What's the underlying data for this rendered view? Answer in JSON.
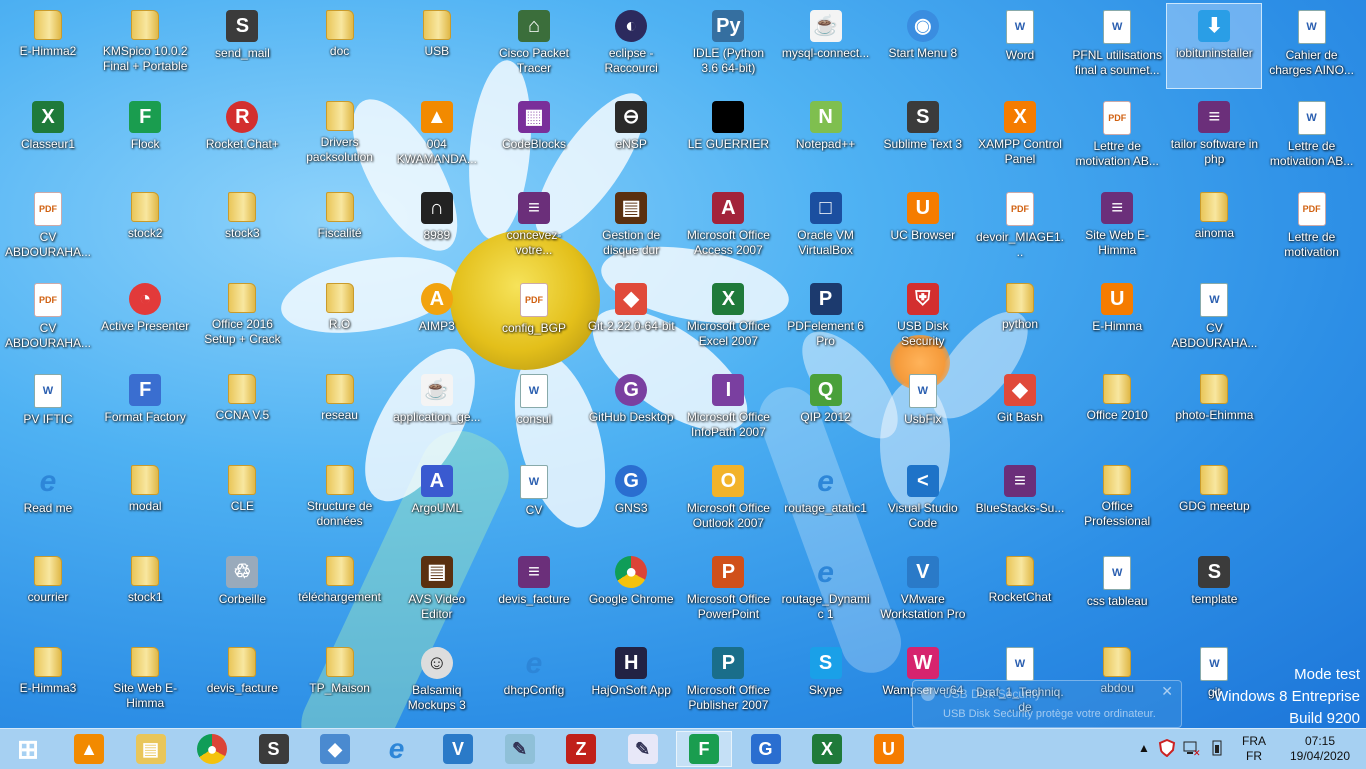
{
  "desktop": {
    "icons": [
      {
        "label": "E-Himma2",
        "glyph": "folder",
        "col": 0,
        "row": 0
      },
      {
        "label": "KMSpico 10.0.2 Final + Portable",
        "glyph": "folder",
        "col": 1,
        "row": 0
      },
      {
        "label": "send_mail",
        "glyph": "sublime",
        "col": 2,
        "row": 0
      },
      {
        "label": "doc",
        "glyph": "folder",
        "col": 3,
        "row": 0
      },
      {
        "label": "USB",
        "glyph": "folder",
        "col": 4,
        "row": 0
      },
      {
        "label": "Cisco Packet Tracer",
        "glyph": "cisco",
        "col": 5,
        "row": 0
      },
      {
        "label": "eclipse - Raccourci",
        "glyph": "eclipse",
        "col": 6,
        "row": 0
      },
      {
        "label": "IDLE (Python 3.6 64-bit)",
        "glyph": "python",
        "col": 7,
        "row": 0
      },
      {
        "label": "mysql-connect...",
        "glyph": "java",
        "col": 8,
        "row": 0
      },
      {
        "label": "Start Menu 8",
        "glyph": "startmenu",
        "col": 9,
        "row": 0
      },
      {
        "label": "Word",
        "glyph": "doc",
        "col": 10,
        "row": 0
      },
      {
        "label": "PFNL utilisations final a soumet...",
        "glyph": "doc",
        "col": 11,
        "row": 0
      },
      {
        "label": "iobituninstaller",
        "glyph": "iobit",
        "col": 12,
        "row": 0,
        "selected": true
      },
      {
        "label": "Cahier de charges AINO...",
        "glyph": "doc",
        "col": 13,
        "row": 0
      },
      {
        "label": "Classeur1",
        "glyph": "excel",
        "col": 0,
        "row": 1
      },
      {
        "label": "Flock",
        "glyph": "flock",
        "col": 1,
        "row": 1
      },
      {
        "label": "Rocket.Chat+",
        "glyph": "rocket",
        "col": 2,
        "row": 1
      },
      {
        "label": "Drivers packsolution",
        "glyph": "folder",
        "col": 3,
        "row": 1
      },
      {
        "label": "004 KWAMANDA...",
        "glyph": "vlc",
        "col": 4,
        "row": 1
      },
      {
        "label": "CodeBlocks",
        "glyph": "codeblocks",
        "col": 5,
        "row": 1
      },
      {
        "label": "eNSP",
        "glyph": "ensp",
        "col": 6,
        "row": 1
      },
      {
        "label": "LE GUERRIER",
        "glyph": "black",
        "col": 7,
        "row": 1
      },
      {
        "label": "Notepad++",
        "glyph": "notepad",
        "col": 8,
        "row": 1
      },
      {
        "label": "Sublime Text 3",
        "glyph": "sublime",
        "col": 9,
        "row": 1
      },
      {
        "label": "XAMPP Control Panel",
        "glyph": "xampp",
        "col": 10,
        "row": 1
      },
      {
        "label": "Lettre de motivation  AB...",
        "glyph": "pdf",
        "col": 11,
        "row": 1
      },
      {
        "label": "tailor software in php",
        "glyph": "rar",
        "col": 12,
        "row": 1
      },
      {
        "label": "Lettre de motivation  AB...",
        "glyph": "doc",
        "col": 13,
        "row": 1
      },
      {
        "label": "CV ABDOURAHA...",
        "glyph": "pdf",
        "col": 0,
        "row": 2
      },
      {
        "label": "stock2",
        "glyph": "folder",
        "col": 1,
        "row": 2
      },
      {
        "label": "stock3",
        "glyph": "folder",
        "col": 2,
        "row": 2
      },
      {
        "label": "Fiscalité",
        "glyph": "folder",
        "col": 3,
        "row": 2
      },
      {
        "label": "8989",
        "glyph": "mcafee",
        "col": 4,
        "row": 2
      },
      {
        "label": "concevez-votre...",
        "glyph": "rar",
        "col": 5,
        "row": 2
      },
      {
        "label": "Gestion de disque dur",
        "glyph": "film",
        "col": 6,
        "row": 2
      },
      {
        "label": "Microsoft Office Access 2007",
        "glyph": "access",
        "col": 7,
        "row": 2
      },
      {
        "label": "Oracle VM VirtualBox",
        "glyph": "vbox",
        "col": 8,
        "row": 2
      },
      {
        "label": "UC Browser",
        "glyph": "uc",
        "col": 9,
        "row": 2
      },
      {
        "label": "devoir_MIAGE1...",
        "glyph": "pdf",
        "col": 10,
        "row": 2
      },
      {
        "label": "Site Web E-Himma",
        "glyph": "rar",
        "col": 11,
        "row": 2
      },
      {
        "label": "ainoma",
        "glyph": "folder",
        "col": 12,
        "row": 2
      },
      {
        "label": "Lettre de motivation",
        "glyph": "pdf",
        "col": 13,
        "row": 2
      },
      {
        "label": "CV ABDOURAHA...",
        "glyph": "pdf",
        "col": 0,
        "row": 3
      },
      {
        "label": "Active Presenter",
        "glyph": "activepresenter",
        "col": 1,
        "row": 3
      },
      {
        "label": "Office 2016 Setup + Crack",
        "glyph": "folder",
        "col": 2,
        "row": 3
      },
      {
        "label": "R.O",
        "glyph": "folder",
        "col": 3,
        "row": 3
      },
      {
        "label": "AIMP3",
        "glyph": "aimp",
        "col": 4,
        "row": 3
      },
      {
        "label": "config_BGP",
        "glyph": "pdf",
        "col": 5,
        "row": 3
      },
      {
        "label": "Git-2.22.0-64-bit",
        "glyph": "gitinstall",
        "col": 6,
        "row": 3
      },
      {
        "label": "Microsoft Office Excel 2007",
        "glyph": "excel",
        "col": 7,
        "row": 3
      },
      {
        "label": "PDFelement 6 Pro",
        "glyph": "pdfelement",
        "col": 8,
        "row": 3
      },
      {
        "label": "USB Disk Security",
        "glyph": "usbdisk",
        "col": 9,
        "row": 3
      },
      {
        "label": "python",
        "glyph": "folder",
        "col": 10,
        "row": 3
      },
      {
        "label": "E-Himma",
        "glyph": "uc",
        "col": 11,
        "row": 3
      },
      {
        "label": "CV ABDOURAHA...",
        "glyph": "doc",
        "col": 12,
        "row": 3
      },
      {
        "label": "PV IFTIC",
        "glyph": "doc",
        "col": 0,
        "row": 4
      },
      {
        "label": "Format Factory",
        "glyph": "formatfactory",
        "col": 1,
        "row": 4
      },
      {
        "label": "CCNA V.5",
        "glyph": "folder",
        "col": 2,
        "row": 4
      },
      {
        "label": "reseau",
        "glyph": "folder",
        "col": 3,
        "row": 4
      },
      {
        "label": "application_ge...",
        "glyph": "java",
        "col": 4,
        "row": 4
      },
      {
        "label": "consul",
        "glyph": "doc",
        "col": 5,
        "row": 4
      },
      {
        "label": "GitHub Desktop",
        "glyph": "github",
        "col": 6,
        "row": 4
      },
      {
        "label": "Microsoft Office InfoPath 2007",
        "glyph": "infopath",
        "col": 7,
        "row": 4
      },
      {
        "label": "QIP 2012",
        "glyph": "qip",
        "col": 8,
        "row": 4
      },
      {
        "label": "UsbFix",
        "glyph": "doc",
        "col": 9,
        "row": 4
      },
      {
        "label": "Git Bash",
        "glyph": "gitinstall",
        "col": 10,
        "row": 4
      },
      {
        "label": "Office 2010",
        "glyph": "folder",
        "col": 11,
        "row": 4
      },
      {
        "label": "photo-Ehimma",
        "glyph": "folder",
        "col": 12,
        "row": 4
      },
      {
        "label": "Read me",
        "glyph": "ie",
        "col": 0,
        "row": 5
      },
      {
        "label": "modal",
        "glyph": "folder",
        "col": 1,
        "row": 5
      },
      {
        "label": "CLE",
        "glyph": "folder",
        "col": 2,
        "row": 5
      },
      {
        "label": "Structure de données",
        "glyph": "folder",
        "col": 3,
        "row": 5
      },
      {
        "label": "ArgoUML",
        "glyph": "argouml",
        "col": 4,
        "row": 5
      },
      {
        "label": "CV",
        "glyph": "doc",
        "col": 5,
        "row": 5
      },
      {
        "label": "GNS3",
        "glyph": "gns3",
        "col": 6,
        "row": 5
      },
      {
        "label": "Microsoft Office Outlook 2007",
        "glyph": "outlook",
        "col": 7,
        "row": 5
      },
      {
        "label": "routage_atatic1",
        "glyph": "ie",
        "col": 8,
        "row": 5
      },
      {
        "label": "Visual Studio Code",
        "glyph": "vscode",
        "col": 9,
        "row": 5
      },
      {
        "label": "BlueStacks-Su...",
        "glyph": "rar",
        "col": 10,
        "row": 5
      },
      {
        "label": "Office Professional Pl...",
        "glyph": "folder",
        "col": 11,
        "row": 5
      },
      {
        "label": "GDG meetup",
        "glyph": "folder",
        "col": 12,
        "row": 5
      },
      {
        "label": "courrier",
        "glyph": "folder",
        "col": 0,
        "row": 6
      },
      {
        "label": "stock1",
        "glyph": "folder",
        "col": 1,
        "row": 6
      },
      {
        "label": "Corbeille",
        "glyph": "recycle",
        "col": 2,
        "row": 6
      },
      {
        "label": "téléchargement",
        "glyph": "folder",
        "col": 3,
        "row": 6
      },
      {
        "label": "AVS Video Editor",
        "glyph": "film",
        "col": 4,
        "row": 6
      },
      {
        "label": "devis_facture",
        "glyph": "rar",
        "col": 5,
        "row": 6
      },
      {
        "label": "Google Chrome",
        "glyph": "chrome",
        "col": 6,
        "row": 6
      },
      {
        "label": "Microsoft Office PowerPoint 2007",
        "glyph": "powerpoint",
        "col": 7,
        "row": 6
      },
      {
        "label": "routage_Dynamic 1",
        "glyph": "ie",
        "col": 8,
        "row": 6
      },
      {
        "label": "VMware Workstation Pro",
        "glyph": "vmware",
        "col": 9,
        "row": 6
      },
      {
        "label": "RocketChat",
        "glyph": "folder",
        "col": 10,
        "row": 6
      },
      {
        "label": "css tableau",
        "glyph": "doc",
        "col": 11,
        "row": 6
      },
      {
        "label": "template",
        "glyph": "sublime",
        "col": 12,
        "row": 6
      },
      {
        "label": "E-Himma3",
        "glyph": "folder",
        "col": 0,
        "row": 7
      },
      {
        "label": "Site Web E-Himma",
        "glyph": "folder",
        "col": 1,
        "row": 7
      },
      {
        "label": "devis_facture",
        "glyph": "folder",
        "col": 2,
        "row": 7
      },
      {
        "label": "TP_Maison",
        "glyph": "folder",
        "col": 3,
        "row": 7
      },
      {
        "label": "Balsamiq Mockups 3",
        "glyph": "balsamiq",
        "col": 4,
        "row": 7
      },
      {
        "label": "dhcpConfig",
        "glyph": "ie",
        "col": 5,
        "row": 7
      },
      {
        "label": "HajOnSoft App",
        "glyph": "hajonsoft",
        "col": 6,
        "row": 7
      },
      {
        "label": "Microsoft Office Publisher 2007",
        "glyph": "publisher",
        "col": 7,
        "row": 7
      },
      {
        "label": "Skype",
        "glyph": "skype",
        "col": 8,
        "row": 7
      },
      {
        "label": "Wampserver64",
        "glyph": "wamp",
        "col": 9,
        "row": 7
      },
      {
        "label": "Draf_1_Techniq... de regeneration...",
        "glyph": "doc",
        "col": 10,
        "row": 7
      },
      {
        "label": "abdou",
        "glyph": "folder",
        "col": 11,
        "row": 7
      },
      {
        "label": "git",
        "glyph": "doc",
        "col": 12,
        "row": 7
      }
    ]
  },
  "watermark": {
    "line1": "Mode test",
    "line2": "Windows 8 Entreprise",
    "line3": "Build 9200"
  },
  "notification": {
    "title": "USB Disk Security",
    "body": "USB Disk Security protège votre ordinateur.",
    "close": "✕"
  },
  "taskbar": {
    "pinned": [
      {
        "name": "start-button",
        "icon": "windows-logo-icon"
      },
      {
        "name": "vlc-pinned",
        "icon": "vlc-icon"
      },
      {
        "name": "file-explorer-pinned",
        "icon": "folder-explorer-icon"
      },
      {
        "name": "chrome-pinned",
        "icon": "chrome-icon"
      },
      {
        "name": "sublime-pinned",
        "icon": "sublime-icon"
      },
      {
        "name": "git-pinned",
        "icon": "git-icon"
      },
      {
        "name": "ie-pinned",
        "icon": "ie-icon"
      },
      {
        "name": "vmware-pinned",
        "icon": "vmware-icon"
      },
      {
        "name": "notepad-pinned",
        "icon": "notepad-icon"
      },
      {
        "name": "filezilla-pinned",
        "icon": "filezilla-icon"
      },
      {
        "name": "editor-pinned",
        "icon": "pen-icon"
      },
      {
        "name": "flock-pinned",
        "icon": "flock-icon",
        "active": true
      },
      {
        "name": "gns3-pinned",
        "icon": "gns3-icon"
      },
      {
        "name": "excel-pinned",
        "icon": "excel-icon"
      },
      {
        "name": "uc-browser-pinned",
        "icon": "uc-browser-icon"
      }
    ],
    "tray": {
      "language_top": "FRA",
      "language_bottom": "FR",
      "time": "07:15",
      "date": "19/04/2020"
    }
  }
}
